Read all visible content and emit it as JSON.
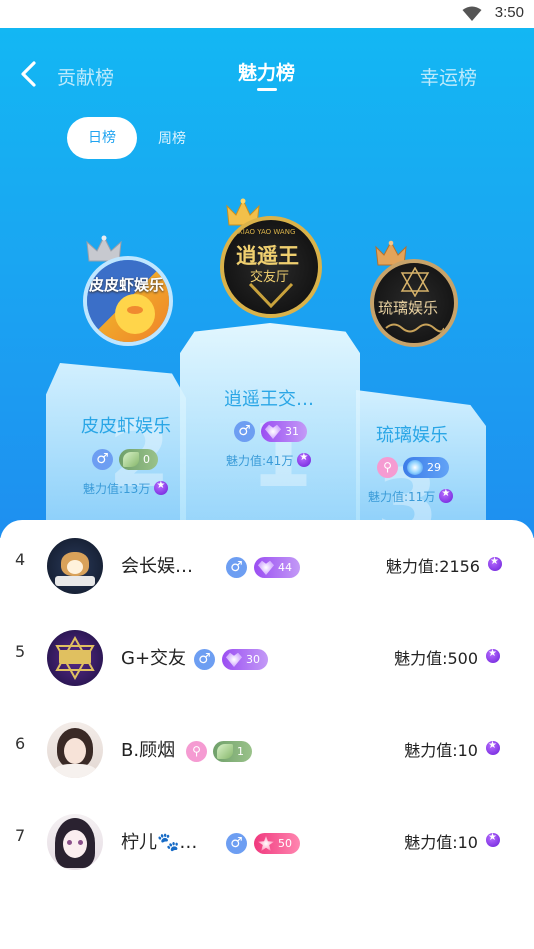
{
  "status_bar": {
    "time": "3:50",
    "wifi_icon": "wifi-icon"
  },
  "header": {
    "tabs": [
      {
        "label": "贡献榜",
        "active": false
      },
      {
        "label": "魅力榜",
        "active": true
      },
      {
        "label": "幸运榜",
        "active": false
      }
    ],
    "period_tabs": [
      {
        "label": "日榜",
        "active": true
      },
      {
        "label": "周榜",
        "active": false
      }
    ]
  },
  "podium": {
    "first": {
      "rank_ghost": "1",
      "name": "逍遥王交…",
      "avatar_text": "逍遥王",
      "avatar_sub": "交友厅",
      "avatar_top": "XIAO YAO WANG",
      "gender": "male",
      "badge": {
        "type": "purple",
        "value": "31"
      },
      "charm": "魅力值:41万"
    },
    "second": {
      "rank_ghost": "2",
      "name": "皮皮虾娱乐",
      "avatar_text": "皮皮虾娱乐",
      "gender": "male",
      "badge": {
        "type": "green",
        "value": "0"
      },
      "charm": "魅力值:13万"
    },
    "third": {
      "rank_ghost": "3",
      "name": "琉璃娱乐",
      "avatar_text": "琉璃娱乐",
      "gender": "female",
      "badge": {
        "type": "blue",
        "value": "29"
      },
      "charm": "魅力值:11万"
    }
  },
  "list": [
    {
      "rank": "4",
      "name": "会长娱…",
      "gender": "male",
      "badge": {
        "type": "purple",
        "value": "44"
      },
      "charm": "魅力值:2156"
    },
    {
      "rank": "5",
      "name": "G+交友",
      "gender": "male",
      "badge": {
        "type": "purple",
        "value": "30"
      },
      "charm": "魅力值:500"
    },
    {
      "rank": "6",
      "name": "B.顾烟",
      "gender": "female",
      "badge": {
        "type": "green",
        "value": "1"
      },
      "charm": "魅力值:10"
    },
    {
      "rank": "7",
      "name": "柠儿🐾…",
      "gender": "male",
      "badge": {
        "type": "pink",
        "value": "50"
      },
      "charm": "魅力值:10"
    }
  ],
  "colors": {
    "header_top": "#13b7f3",
    "header_bottom": "#1e8ff0",
    "name_blue": "#2aa6e6",
    "gold": "#d8b04a"
  }
}
